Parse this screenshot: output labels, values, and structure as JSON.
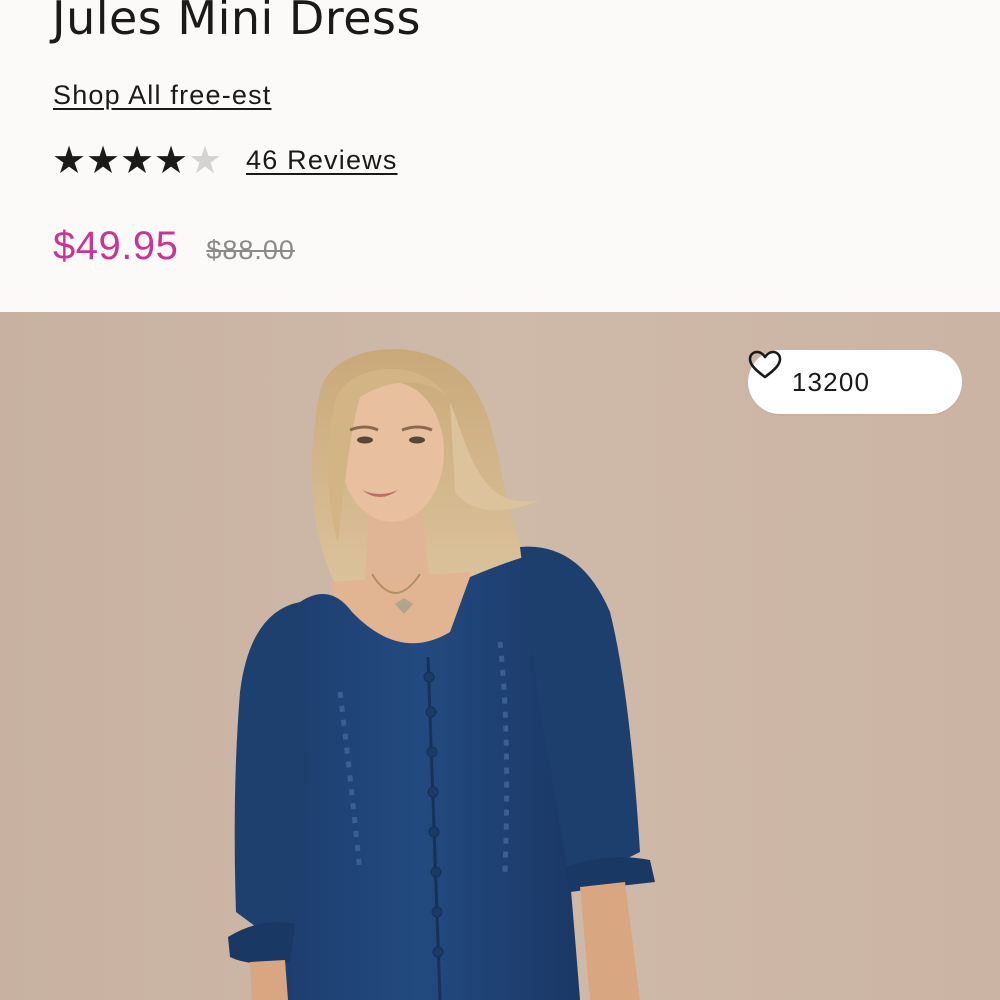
{
  "product": {
    "title": "Jules Mini Dress",
    "brand_link": "Shop All free-est",
    "rating": {
      "value": 4,
      "max": 5,
      "reviews_label": "46 Reviews"
    },
    "price": {
      "sale": "$49.95",
      "original": "$88.00",
      "sale_color": "#c9358f"
    }
  },
  "hero": {
    "favorites_count": "13200",
    "favorite_icon": "heart-icon"
  }
}
